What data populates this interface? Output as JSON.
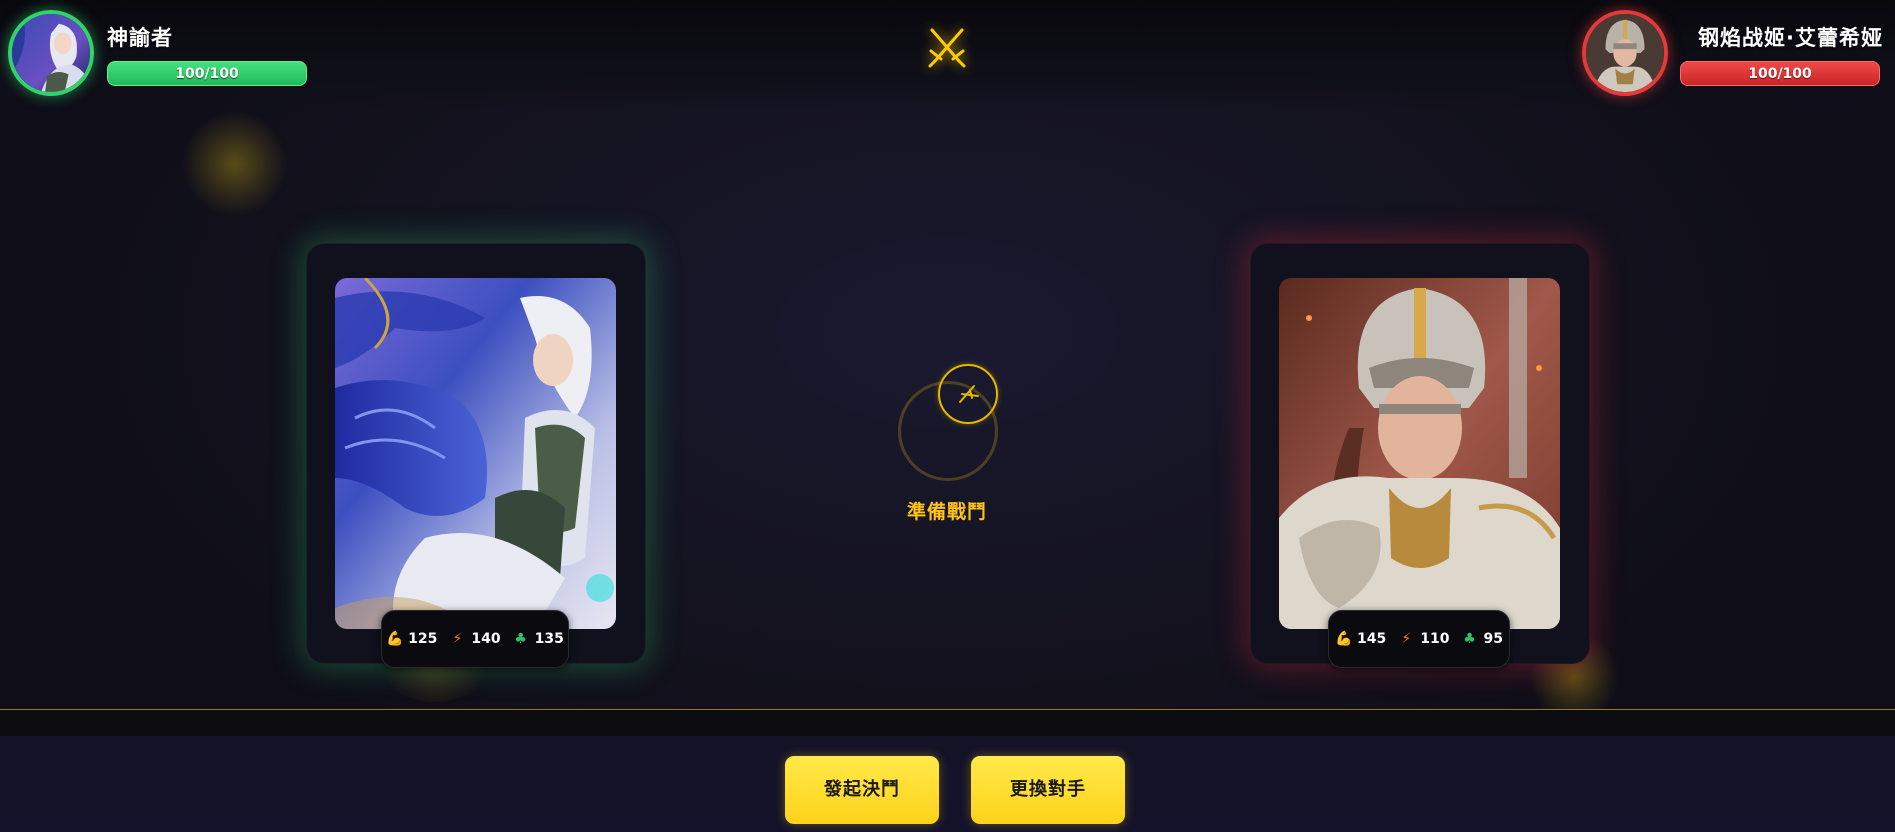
{
  "player": {
    "name": "神諭者",
    "hp": "100/100",
    "hp_fraction": 1.0,
    "accent_color": "#33d16d",
    "stats": {
      "strength": "125",
      "speed": "140",
      "luck": "135"
    }
  },
  "opponent": {
    "name": "钢焰战姬·艾蕾希娅",
    "hp": "100/100",
    "hp_fraction": 1.0,
    "accent_color": "#e33a3a",
    "stats": {
      "strength": "145",
      "speed": "110",
      "luck": "95"
    }
  },
  "battle": {
    "status": "準備戰鬥",
    "center_icon": "crossed-swords-icon"
  },
  "actions": {
    "start_duel": "發起決鬥",
    "change_opponent": "更換對手"
  },
  "icons": {
    "strength": "flexed-arm-icon",
    "speed": "lightning-icon",
    "luck": "clover-icon"
  },
  "colors": {
    "accent_gold": "#ffc21a",
    "button": "#ffd21a"
  }
}
